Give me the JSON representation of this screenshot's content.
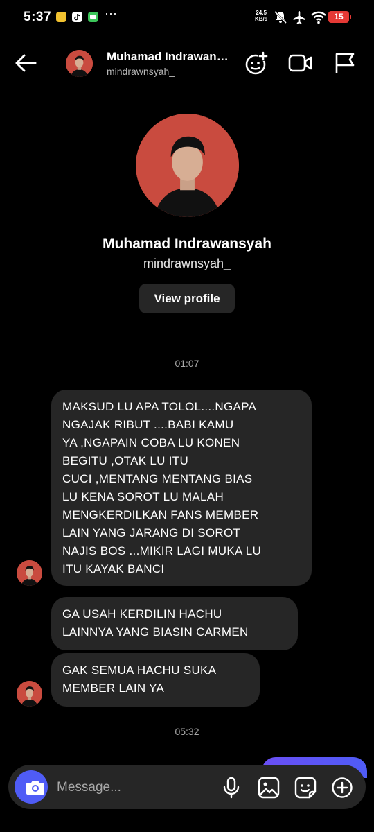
{
  "status_bar": {
    "time": "5:37",
    "more": "···",
    "net_speed_value": "24.5",
    "net_speed_unit": "KB/s",
    "battery": "15",
    "icons": [
      "gallery-app-icon",
      "tiktok-icon",
      "chat-app-icon",
      "mute-icon",
      "airplane-mode-icon",
      "wifi-icon",
      "battery-icon"
    ]
  },
  "header": {
    "name": "Muhamad Indrawansyah",
    "username": "mindrawnsyah_",
    "icons": [
      "back-arrow-icon",
      "avatar",
      "effects-icon",
      "video-call-icon",
      "report-flag-icon"
    ]
  },
  "profile": {
    "name": "Muhamad Indrawansyah",
    "username": "mindrawnsyah_",
    "view_profile_label": "View profile"
  },
  "conversation": {
    "timestamp_1": "01:07",
    "messages": [
      {
        "lines": [
          "MAKSUD LU APA TOLOL....NGAPA",
          "NGAJAK RIBUT ....BABI KAMU",
          "YA ,NGAPAIN COBA LU KONEN",
          "BEGITU ,OTAK LU ITU",
          "CUCI ,MENTANG MENTANG BIAS",
          "LU KENA SOROT LU MALAH",
          "MENGKERDILKAN FANS MEMBER",
          "LAIN YANG JARANG DI SOROT",
          "NAJIS BOS ...MIKIR LAGI MUKA LU",
          "ITU KAYAK BANCI"
        ]
      },
      {
        "lines": [
          "GA USAH KERDILIN HACHU",
          "LAINNYA YANG BIASIN CARMEN"
        ]
      },
      {
        "lines": [
          "GAK SEMUA HACHU SUKA",
          "MEMBER LAIN YA"
        ]
      }
    ],
    "timestamp_2": "05:32"
  },
  "composer": {
    "placeholder": "Message...",
    "icons": [
      "camera-icon",
      "microphone-icon",
      "gallery-icon",
      "sticker-icon",
      "add-icon"
    ]
  },
  "colors": {
    "background": "#000000",
    "bubble": "#262626",
    "accent": "#4f5cf6",
    "avatar_bg": "#c94b3f",
    "battery": "#e53935"
  }
}
